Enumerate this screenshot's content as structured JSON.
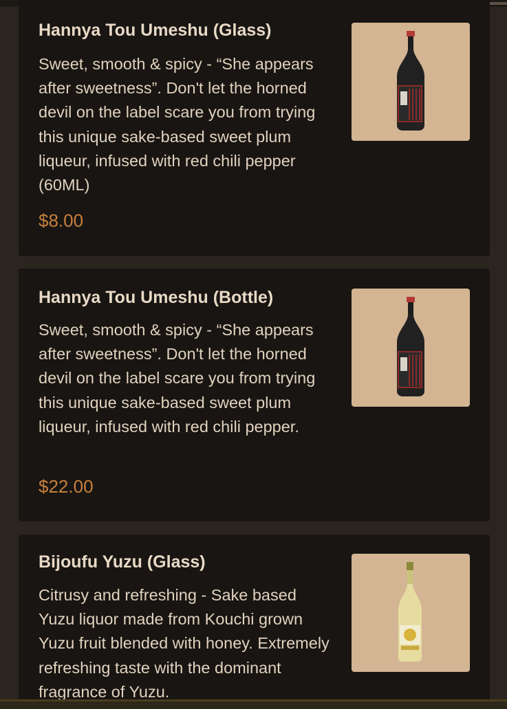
{
  "menu": {
    "items": [
      {
        "title": "Hannya Tou Umeshu (Glass)",
        "description": "Sweet, smooth & spicy - “She appears after sweetness”. Don't let the horned devil on the label scare you from trying this unique sake-based sweet plum liqueur, infused with red chili pepper (60ML)",
        "price": "$8.00",
        "image_icon": "dark-sake-bottle-image"
      },
      {
        "title": "Hannya Tou Umeshu (Bottle)",
        "description": "Sweet, smooth & spicy - “She appears after sweetness”. Don't let the horned devil on the label scare you from trying this unique sake-based sweet plum liqueur, infused with red chili pepper.",
        "price": "$22.00",
        "image_icon": "dark-sake-bottle-image"
      },
      {
        "title": "Bijoufu Yuzu (Glass)",
        "description": "Citrusy and refreshing - Sake based Yuzu liquor made from Kouchi grown Yuzu fruit blended with honey. Extremely refreshing taste with the dominant fragrance of Yuzu.",
        "price": "",
        "image_icon": "yuzu-liquor-bottle-image"
      }
    ]
  },
  "colors": {
    "background": "#2a251e",
    "card": "#181512",
    "title": "#e8d9c6",
    "text": "#e1d2bf",
    "price": "#c7803e",
    "image_bg": "#d3b594"
  }
}
